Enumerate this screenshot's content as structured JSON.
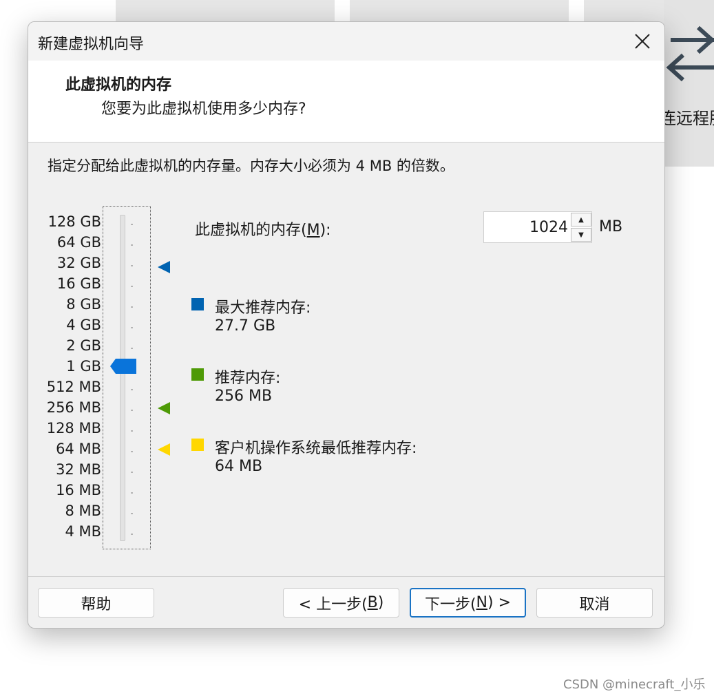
{
  "background_app": {
    "partial_text": "连远程服"
  },
  "dialog": {
    "title": "新建虚拟机向导",
    "header": {
      "title": "此虚拟机的内存",
      "subtitle": "您要为此虚拟机使用多少内存?"
    },
    "description": "指定分配给此虚拟机的内存量。内存大小必须为 4 MB 的倍数。",
    "slider": {
      "tick_labels": [
        "128 GB",
        "64 GB",
        "32 GB",
        "16 GB",
        "8 GB",
        "4 GB",
        "2 GB",
        "1 GB",
        "512 MB",
        "256 MB",
        "128 MB",
        "64 MB",
        "32 MB",
        "16 MB",
        "8 MB",
        "4 MB"
      ],
      "current_value": "1 GB"
    },
    "memory": {
      "label_prefix": "此虚拟机的内存(",
      "label_mnemonic": "M",
      "label_suffix": "):",
      "value": "1024",
      "unit": "MB"
    },
    "legend": [
      {
        "label": "最大推荐内存:",
        "value": "27.7 GB",
        "color": "#0063b1"
      },
      {
        "label": "推荐内存:",
        "value": "256 MB",
        "color": "#4e9a06"
      },
      {
        "label": "客户机操作系统最低推荐内存:",
        "value": "64 MB",
        "color": "#ffd700"
      }
    ],
    "buttons": {
      "help": "帮助",
      "back_prefix": "< 上一步(",
      "back_mnemonic": "B",
      "back_suffix": ")",
      "next_prefix": "下一步(",
      "next_mnemonic": "N",
      "next_suffix": ") >",
      "cancel": "取消"
    }
  },
  "watermark": "CSDN @minecraft_小乐",
  "colors": {
    "thumb": "#0a74da",
    "primary_border": "#1a73c4"
  }
}
